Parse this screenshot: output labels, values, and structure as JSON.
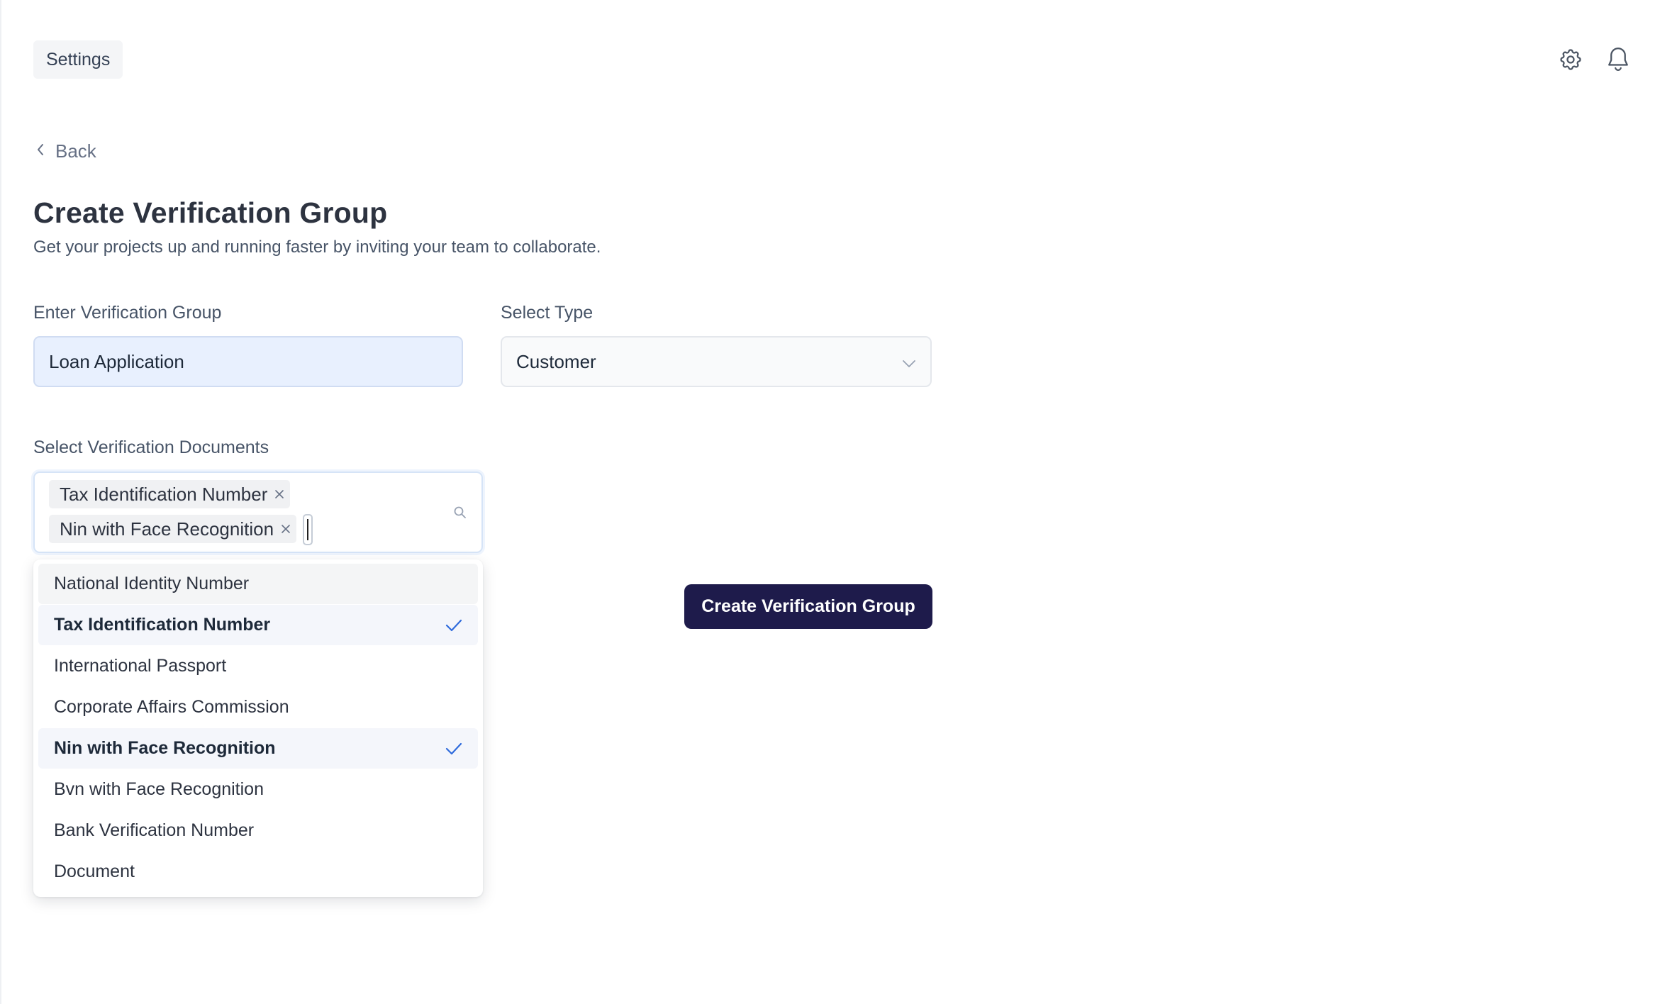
{
  "header": {
    "settings_label": "Settings",
    "icons": [
      "gear-icon",
      "bell-icon"
    ]
  },
  "nav": {
    "back_label": "Back"
  },
  "page": {
    "title": "Create Verification Group",
    "subtitle": "Get your projects up and running faster by inviting your team to collaborate."
  },
  "form": {
    "group_label": "Enter Verification Group",
    "group_value": "Loan Application",
    "type_label": "Select Type",
    "type_value": "Customer",
    "docs_label": "Select Verification Documents",
    "selected_tags": [
      "Tax Identification Number",
      "Nin with Face Recognition"
    ],
    "options": [
      {
        "label": "National Identity Number",
        "selected": false
      },
      {
        "label": "Tax Identification Number",
        "selected": true
      },
      {
        "label": "International Passport",
        "selected": false
      },
      {
        "label": "Corporate Affairs Commission",
        "selected": false
      },
      {
        "label": "Nin with Face Recognition",
        "selected": true
      },
      {
        "label": "Bvn with Face Recognition",
        "selected": false
      },
      {
        "label": "Bank Verification Number",
        "selected": false
      },
      {
        "label": "Document",
        "selected": false
      }
    ],
    "submit_label": "Create Verification Group"
  },
  "colors": {
    "primary_button": "#1e1b4b",
    "input_fill": "#e8f0fe",
    "check_color": "#2f6bdc"
  }
}
